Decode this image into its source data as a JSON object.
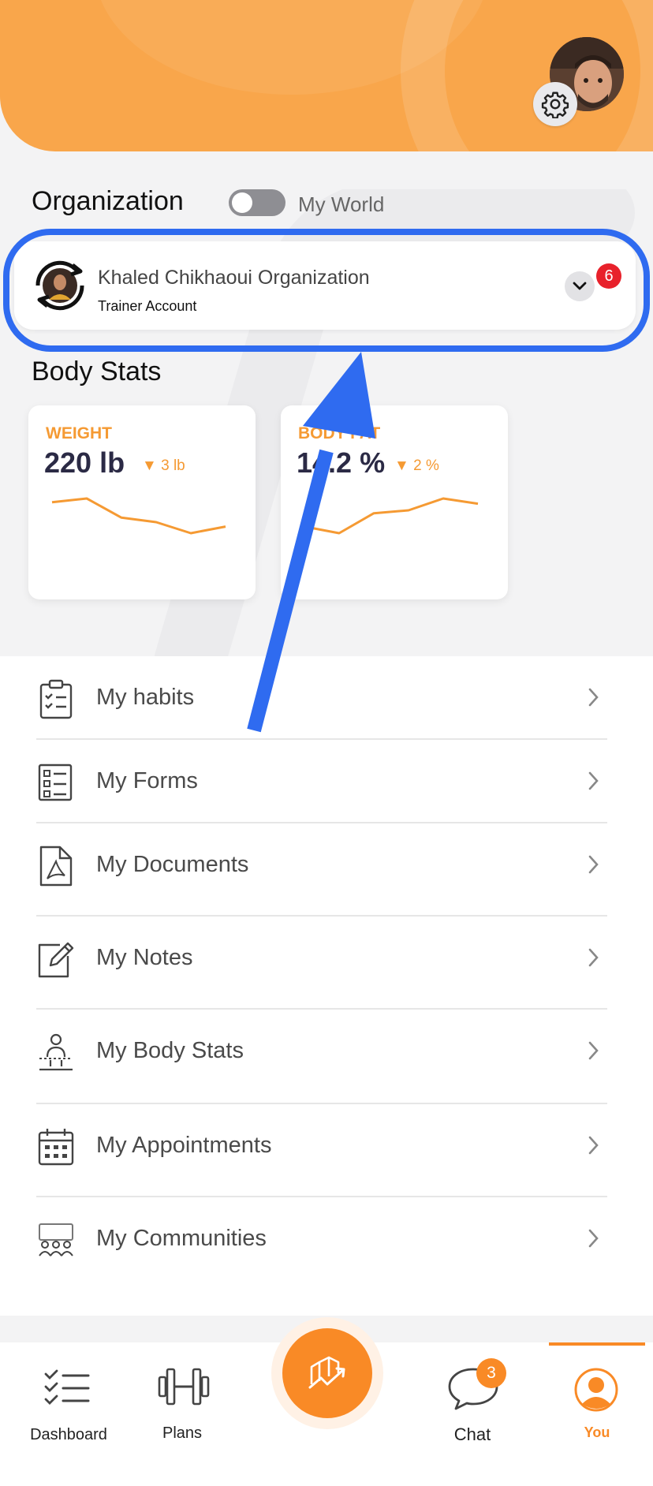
{
  "header": {
    "avatar_icon": "profile-photo",
    "settings_icon": "gear-icon"
  },
  "organization": {
    "title": "Organization",
    "toggle_label": "My World",
    "toggle_on": false,
    "org_name": "Khaled Chikhaoui Organization",
    "org_subtitle": "Trainer Account",
    "notification_count": "6"
  },
  "body_stats": {
    "title": "Body Stats",
    "cards": [
      {
        "label": "WEIGHT",
        "value": "220 lb",
        "delta": "3 lb",
        "series": [
          545,
          540,
          566,
          572,
          587,
          578
        ]
      },
      {
        "label": "BODY FAT",
        "value": "14.2 %",
        "delta": "2 %",
        "series": [
          578,
          587,
          560,
          556,
          540,
          547
        ]
      }
    ]
  },
  "menu": {
    "items": [
      {
        "label": "My habits",
        "icon": "clipboard-checklist-icon"
      },
      {
        "label": "My Forms",
        "icon": "form-checklist-icon"
      },
      {
        "label": "My Documents",
        "icon": "pdf-document-icon"
      },
      {
        "label": "My Notes",
        "icon": "edit-note-icon"
      },
      {
        "label": "My Body Stats",
        "icon": "body-measure-icon"
      },
      {
        "label": "My Appointments",
        "icon": "calendar-icon"
      },
      {
        "label": "My Communities",
        "icon": "community-icon"
      }
    ]
  },
  "nav": {
    "dashboard": "Dashboard",
    "plans": "Plans",
    "chat": "Chat",
    "chat_badge": "3",
    "you": "You",
    "active": "You",
    "accent": "#F98A26"
  },
  "colors": {
    "brand": "#F9A64B",
    "accent": "#F59A33",
    "highlight": "#2F6BF0",
    "badge": "#E8212B"
  }
}
